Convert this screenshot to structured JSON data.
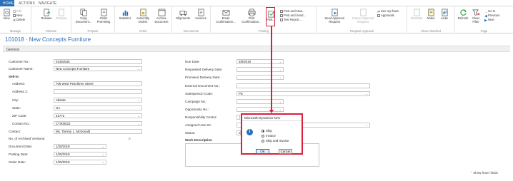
{
  "ribbon_tabs": {
    "home": "HOME",
    "actions": "ACTIONS",
    "navigate": "NAVIGATE"
  },
  "ribbon": {
    "manage": {
      "label": "Manage",
      "view": "View",
      "edit": "Edit",
      "new": "New",
      "delete": "Delete"
    },
    "release": {
      "label": "Release",
      "release": "Release",
      "reopen": "Reopen"
    },
    "prepare": {
      "label": "Prepare",
      "copy_document_1": "Copy",
      "copy_document_2": "Document...",
      "order_promising_1": "Order",
      "order_promising_2": "Promising"
    },
    "order": {
      "label": "Order",
      "statistics": "Statistics",
      "assembly_orders_1": "Assembly",
      "assembly_orders_2": "Orders",
      "archive_document_1": "Archive",
      "archive_document_2": "Document"
    },
    "documents": {
      "label": "Documents",
      "shipments": "Shipments",
      "invoices": "Invoices"
    },
    "posting": {
      "label": "Posting",
      "email_confirmation_1": "Email",
      "email_confirmation_2": "Confirmation...",
      "print_confirmation_1": "Print",
      "print_confirmation_2": "Confirmation...",
      "post": "Post...",
      "post_and_new": "Post and New...",
      "post_and_send": "Post and Send...",
      "test_report": "Test Report..."
    },
    "request_approval": {
      "label": "Request Approval",
      "send_approval_1": "Send Approval",
      "send_approval_2": "Request",
      "cancel_approval_1": "Cancel Approval",
      "cancel_approval_2": "Request",
      "see_my_flows": "See my flows",
      "approvals": "Approvals"
    },
    "show_attached": {
      "label": "Show Attached",
      "onenote": "OneNote",
      "notes": "Notes",
      "links": "Links"
    },
    "page": {
      "label": "Page",
      "refresh": "Refresh",
      "clear_filter_1": "Clear",
      "clear_filter_2": "Filter",
      "go_to": "Go to",
      "previous": "Previous",
      "next": "Next"
    }
  },
  "page_title": "101018 · New Concepts Furniture",
  "section_general": "General",
  "form": {
    "customer_no": {
      "label": "Customer No.:",
      "value": "01454545"
    },
    "customer_name": {
      "label": "Customer Name:",
      "value": "New Concepts Furniture"
    },
    "sell_to": "Sell-to",
    "address": {
      "label": "Address:",
      "value": "705 West Peachtree Street"
    },
    "address2": {
      "label": "Address 2:",
      "value": ""
    },
    "city": {
      "label": "City:",
      "value": "Atlanta"
    },
    "state": {
      "label": "State:",
      "value": "GA"
    },
    "zip": {
      "label": "ZIP Code:",
      "value": "31772"
    },
    "contact_no": {
      "label": "Contact No.:",
      "value": "CT000022"
    },
    "contact": {
      "label": "Contact:",
      "value": "Ms. Tammy L. McDonald"
    },
    "archived_versions": {
      "label": "No. of Archived Versions:",
      "value": "0"
    },
    "document_date": {
      "label": "Document Date:",
      "value": "1/25/2019"
    },
    "posting_date": {
      "label": "Posting Date:",
      "value": "1/25/2019"
    },
    "order_date": {
      "label": "Order Date:",
      "value": "1/25/2019"
    },
    "due_date": {
      "label": "Due Date:",
      "value": "2/8/2019"
    },
    "requested_delivery": {
      "label": "Requested Delivery Date:",
      "value": ""
    },
    "promised_delivery": {
      "label": "Promised Delivery Date:",
      "value": ""
    },
    "external_doc": {
      "label": "External Document No.:",
      "value": ""
    },
    "salesperson": {
      "label": "Salesperson Code:",
      "value": "PS"
    },
    "campaign": {
      "label": "Campaign No.:",
      "value": ""
    },
    "opportunity": {
      "label": "Opportunity No.:",
      "value": ""
    },
    "responsibility": {
      "label": "Responsibility Center:",
      "value": ""
    },
    "assigned_user": {
      "label": "Assigned User ID:",
      "value": ""
    },
    "status": {
      "label": "Status:",
      "value": "O"
    },
    "work_description": "Work Description"
  },
  "show_fewer": "Show fewer fields",
  "dialog": {
    "title": "Microsoft Dynamics NAV",
    "options": [
      "Ship",
      "Invoice",
      "Ship and Invoice"
    ],
    "selected": "Ship",
    "ok": "OK",
    "cancel": "Cancel"
  },
  "colors": {
    "accent": "#2b6fb6",
    "highlight": "#d9203a"
  }
}
